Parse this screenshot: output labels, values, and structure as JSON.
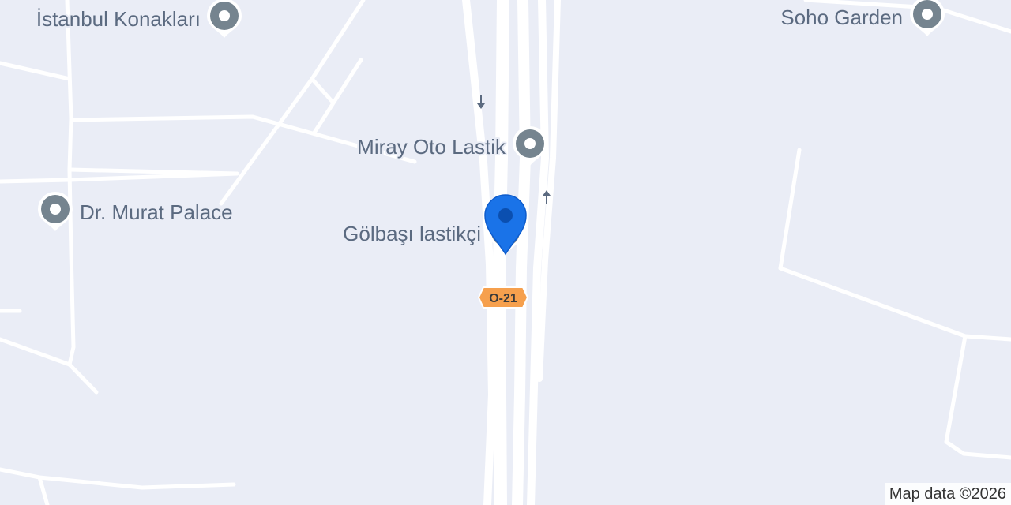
{
  "map": {
    "places": [
      {
        "name": "İstanbul Konakları",
        "icon": "place-pin-icon"
      },
      {
        "name": "Soho Garden",
        "icon": "place-pin-icon"
      },
      {
        "name": "Miray Oto Lastik",
        "icon": "place-pin-icon"
      },
      {
        "name": "Dr. Murat Palace",
        "icon": "place-pin-icon"
      },
      {
        "name": "Gölbaşı lastikçi",
        "icon": "place-pin-icon"
      }
    ],
    "selected_marker": {
      "icon": "location-marker-icon",
      "color": "#1a73e8"
    },
    "road_shield": {
      "label": "O-21",
      "color": "#f6a04d"
    },
    "one_way_arrows": [
      "one-way-arrow-down-icon",
      "one-way-arrow-up-icon"
    ],
    "colors": {
      "background": "#eaedf6",
      "road": "#ffffff",
      "label": "#5b6a80",
      "poi_pin": "#75848f"
    }
  },
  "attribution": "Map data ©2026"
}
